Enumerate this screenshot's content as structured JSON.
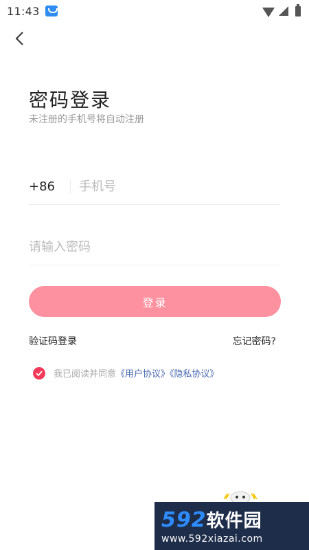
{
  "status_bar": {
    "time": "11:43"
  },
  "header": {
    "title": "密码登录",
    "subtitle": "未注册的手机号将自动注册"
  },
  "phone": {
    "country_code": "+86",
    "placeholder": "手机号"
  },
  "password": {
    "placeholder": "请输入密码"
  },
  "login_button": {
    "label": "登录"
  },
  "links": {
    "sms_login": "验证码登录",
    "forgot_password": "忘记密码?"
  },
  "agreement": {
    "text": "我已阅读并同意",
    "user_agreement": "《用户协议》",
    "privacy_policy": "《隐私协议》",
    "checked": true
  },
  "watermark": {
    "brand_num": "592",
    "brand_cn": "软件园",
    "url": "www.592xiazai.com"
  },
  "colors": {
    "accent": "#fd919f",
    "check": "#f23a5a",
    "link": "#4a6ab0"
  }
}
